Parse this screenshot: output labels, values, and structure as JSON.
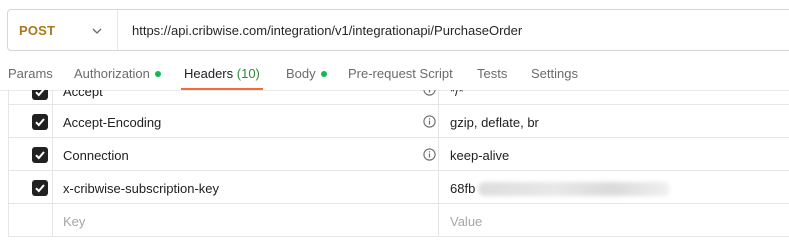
{
  "request": {
    "method": "POST",
    "url": "https://api.cribwise.com/integration/v1/integrationapi/PurchaseOrder"
  },
  "tabs": [
    {
      "label": "Params"
    },
    {
      "label": "Authorization"
    },
    {
      "label": "Headers",
      "count": "(10)"
    },
    {
      "label": "Body"
    },
    {
      "label": "Pre-request Script"
    },
    {
      "label": "Tests"
    },
    {
      "label": "Settings"
    }
  ],
  "headers": [
    {
      "key": "Accept",
      "value": "*/*",
      "checked": true,
      "info": true
    },
    {
      "key": "Accept-Encoding",
      "value": "gzip, deflate, br",
      "checked": true,
      "info": true
    },
    {
      "key": "Connection",
      "value": "keep-alive",
      "checked": true,
      "info": true
    },
    {
      "key": "x-cribwise-subscription-key",
      "value": "68fb",
      "checked": true,
      "info": false
    }
  ],
  "new_row": {
    "key_placeholder": "Key",
    "value_placeholder": "Value"
  },
  "colors": {
    "method": "#a8791d",
    "active_tab_underline": "#f26b3a",
    "status_dot": "#0cbb52"
  },
  "icons": [
    "chevron-down-icon",
    "check-icon",
    "info-icon"
  ]
}
